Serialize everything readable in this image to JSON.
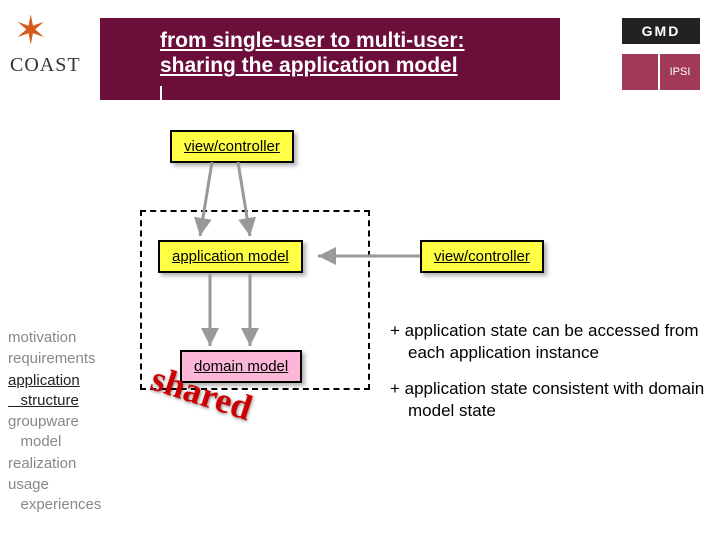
{
  "header": {
    "line1": "from single-user to multi-user:",
    "line2": "sharing the application model"
  },
  "logos": {
    "coast": "COAST",
    "gmd": "GMD",
    "ipsi": "IPSI"
  },
  "boxes": {
    "vc1": "view/controller",
    "am": "application model",
    "vc2": "view/controller",
    "dm": "domain model"
  },
  "shared_label": "shared",
  "nav": {
    "items": [
      "motivation",
      "requirements",
      "application structure",
      "groupware model",
      "realization",
      "usage experiences"
    ],
    "active_index": 2
  },
  "bullets": {
    "b1": "+ application state can be accessed from each application instance",
    "b2": "+ application state consistent with domain model state"
  }
}
